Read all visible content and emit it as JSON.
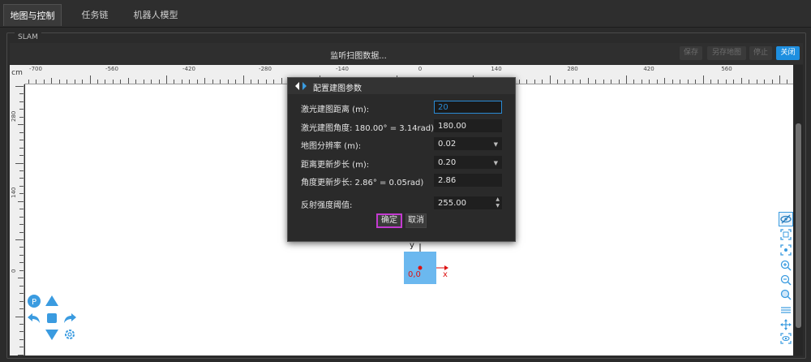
{
  "tabs": [
    {
      "label": "地图与控制"
    },
    {
      "label": "任务链"
    },
    {
      "label": "机器人模型"
    }
  ],
  "panel": {
    "title": "SLAM"
  },
  "toolbar": {
    "status": "监听扫图数据...",
    "save": "保存",
    "save_local": "另存地图",
    "stop": "停止",
    "close": "关闭"
  },
  "ruler": {
    "unit": "cm",
    "x_ticks": [
      "-700",
      "-560",
      "-420",
      "-280",
      "-140",
      "0",
      "140",
      "280",
      "420",
      "560"
    ],
    "y_ticks": [
      "280",
      "140",
      "0"
    ]
  },
  "map": {
    "origin_label": "0,0",
    "x_axis_label": "x",
    "y_axis_label": "y"
  },
  "dialog": {
    "title": "配置建图参数",
    "fields": [
      {
        "label": "激光建图距离 (m):",
        "value": "20"
      },
      {
        "label": "激光建图角度: 180.00° = 3.14rad)",
        "value": "180.00"
      },
      {
        "label": "地图分辨率 (m):",
        "value": "0.02"
      },
      {
        "label": "距离更新步长 (m):",
        "value": "0.20"
      },
      {
        "label": "角度更新步长: 2.86° = 0.05rad)",
        "value": "2.86"
      },
      {
        "label": "反射强度阈值:",
        "value": "255.00"
      }
    ],
    "ok": "确定",
    "cancel": "取消"
  },
  "nav": {
    "p_label": "P"
  },
  "colors": {
    "accent": "#1e8fe0",
    "nav_blue": "#3a9be0",
    "robot_fill": "#6bb8ef",
    "highlight": "#c33ad0",
    "origin_red": "#dd1111"
  }
}
